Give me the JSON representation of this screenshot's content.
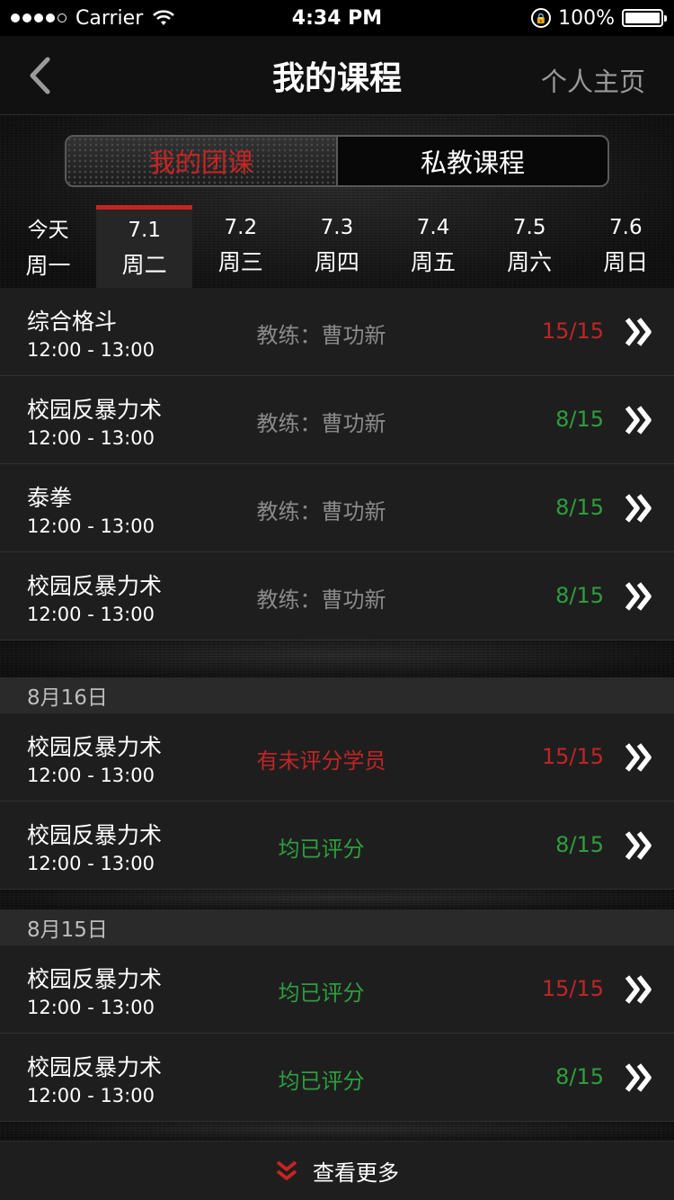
{
  "status_bar": {
    "carrier": "Carrier",
    "time": "4:34 PM",
    "battery": "100%"
  },
  "nav": {
    "title": "我的课程",
    "right_link": "个人主页"
  },
  "segments": [
    {
      "label": "我的团课",
      "active": true
    },
    {
      "label": "私教课程",
      "active": false
    }
  ],
  "week": [
    {
      "date": "今天",
      "weekday": "周一"
    },
    {
      "date": "7.1",
      "weekday": "周二"
    },
    {
      "date": "7.2",
      "weekday": "周三"
    },
    {
      "date": "7.3",
      "weekday": "周四"
    },
    {
      "date": "7.4",
      "weekday": "周五"
    },
    {
      "date": "7.5",
      "weekday": "周六"
    },
    {
      "date": "7.6",
      "weekday": "周日"
    }
  ],
  "today_courses": [
    {
      "name": "综合格斗",
      "time": "12:00 - 13:00",
      "coach": "教练：曹功新",
      "count": "15/15",
      "count_color": "red"
    },
    {
      "name": "校园反暴力术",
      "time": "12:00 - 13:00",
      "coach": "教练：曹功新",
      "count": "8/15",
      "count_color": "green"
    },
    {
      "name": "泰拳",
      "time": "12:00 - 13:00",
      "coach": "教练：曹功新",
      "count": "8/15",
      "count_color": "green"
    },
    {
      "name": "校园反暴力术",
      "time": "12:00 - 13:00",
      "coach": "教练：曹功新",
      "count": "8/15",
      "count_color": "green"
    }
  ],
  "history": [
    {
      "date": "8月16日",
      "courses": [
        {
          "name": "校园反暴力术",
          "time": "12:00 - 13:00",
          "status": "有未评分学员",
          "status_color": "red",
          "count": "15/15",
          "count_color": "red"
        },
        {
          "name": "校园反暴力术",
          "time": "12:00 - 13:00",
          "status": "均已评分",
          "status_color": "green",
          "count": "8/15",
          "count_color": "green"
        }
      ]
    },
    {
      "date": "8月15日",
      "courses": [
        {
          "name": "校园反暴力术",
          "time": "12:00 - 13:00",
          "status": "均已评分",
          "status_color": "green",
          "count": "15/15",
          "count_color": "red"
        },
        {
          "name": "校园反暴力术",
          "time": "12:00 - 13:00",
          "status": "均已评分",
          "status_color": "green",
          "count": "8/15",
          "count_color": "green"
        }
      ]
    }
  ],
  "footer": {
    "label": "查看更多",
    "icon": "double-chevron-down-icon"
  },
  "colors": {
    "accent_red": "#c82323",
    "status_red": "#c02525",
    "status_green": "#2e9e3e"
  }
}
